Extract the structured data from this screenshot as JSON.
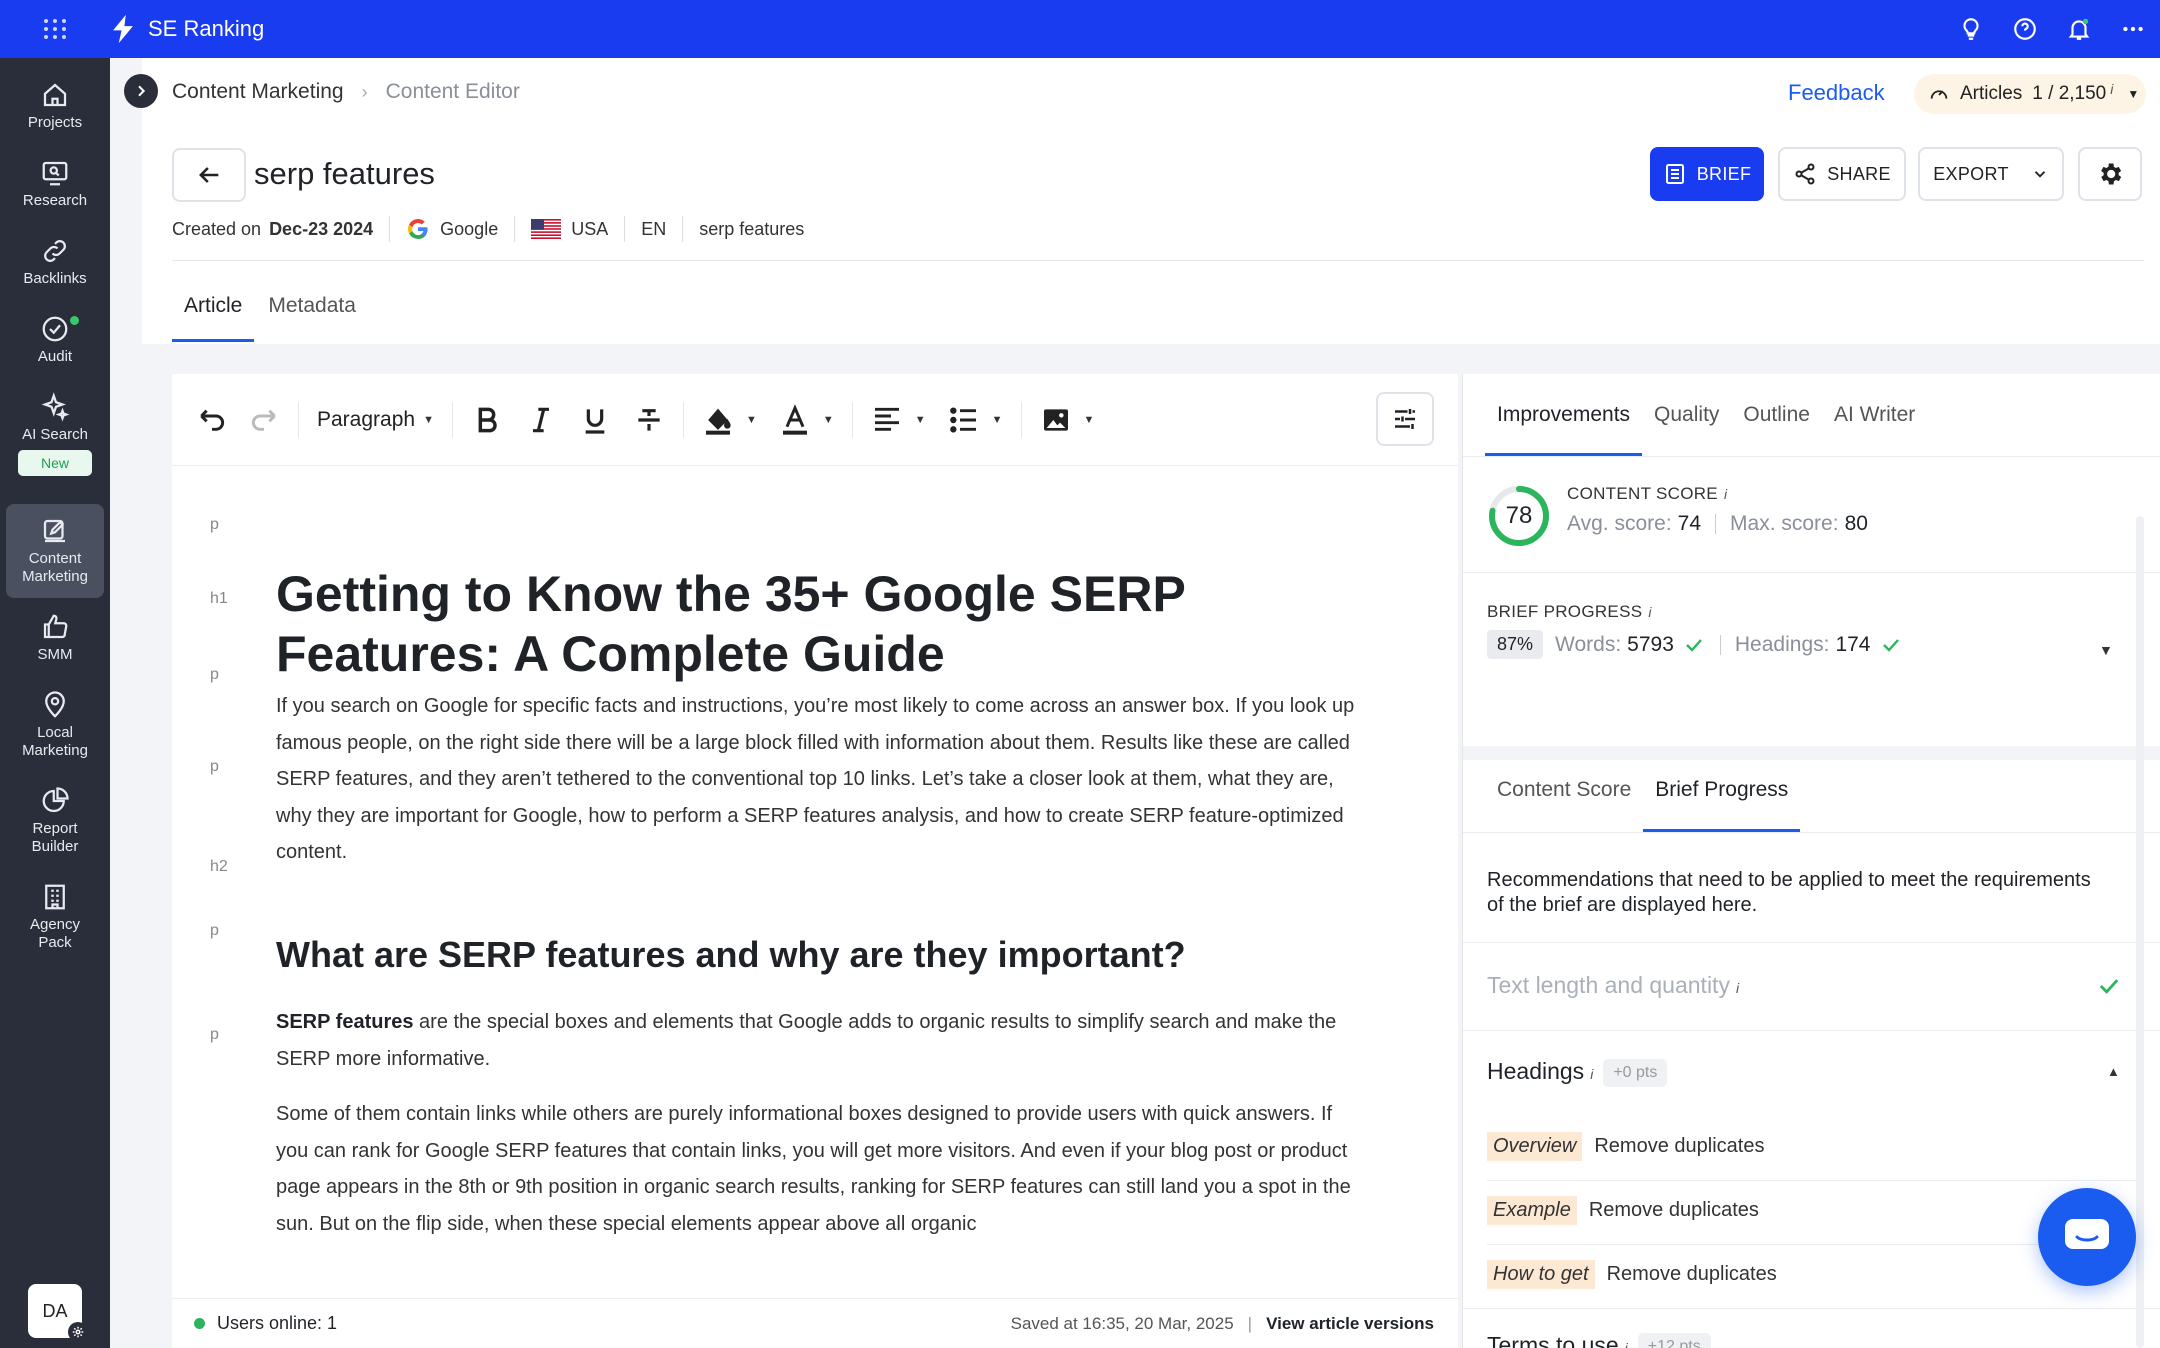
{
  "app": {
    "brand": "SE Ranking"
  },
  "colors": {
    "primary": "#1a3cf0",
    "sidebar": "#2a2e3a",
    "accent_green": "#2bb55d",
    "highlight": "#fde9d3"
  },
  "topbar": {
    "icons": [
      "lightbulb-icon",
      "help-icon",
      "bell-icon",
      "more-icon"
    ]
  },
  "sidebar": {
    "items": [
      {
        "label": "Projects",
        "icon": "home-icon"
      },
      {
        "label": "Research",
        "icon": "research-icon"
      },
      {
        "label": "Backlinks",
        "icon": "link-icon"
      },
      {
        "label": "Audit",
        "icon": "check-circle-icon"
      },
      {
        "label": "AI Search",
        "icon": "sparkle-icon",
        "badge": "New"
      },
      {
        "label": "Content\nMarketing",
        "icon": "edit-icon",
        "active": true
      },
      {
        "label": "SMM",
        "icon": "thumbs-up-icon"
      },
      {
        "label": "Local\nMarketing",
        "icon": "pin-icon"
      },
      {
        "label": "Report\nBuilder",
        "icon": "pie-chart-icon"
      },
      {
        "label": "Agency\nPack",
        "icon": "building-icon"
      }
    ],
    "avatar": "DA"
  },
  "header": {
    "breadcrumb": [
      "Content Marketing",
      "Content Editor"
    ],
    "feedback": "Feedback",
    "articles_label": "Articles",
    "articles_count": "1 / 2,150",
    "info": "i",
    "doc_title": "serp features",
    "created_label": "Created on",
    "created_date": "Dec-23 2024",
    "search_engine": "Google",
    "country": "USA",
    "language": "EN",
    "keyword": "serp features",
    "buttons": {
      "brief": "BRIEF",
      "share": "SHARE",
      "export": "EXPORT"
    },
    "tabs": [
      "Article",
      "Metadata"
    ]
  },
  "editor": {
    "toolbar": {
      "block_format": "Paragraph"
    },
    "tags": [
      "p",
      "h1",
      "p",
      "p",
      "h2",
      "p",
      "p"
    ],
    "h1": "Getting to Know the 35+ Google SERP Features: A Complete Guide",
    "p1": "If you search on Google for specific facts and instructions, you’re most likely to come across an answer box. If you look up famous people, on the right side there will be a large block filled with information about them. Results like these are called SERP features, and they aren’t tethered to the conventional top 10 links. Let’s take a closer look at them, what they are, why they are important for Google, how to perform a SERP features analysis, and how to create SERP feature-optimized content.",
    "h2": "What are SERP features and why are they important?",
    "p2_bold": "SERP features",
    "p2_rest": " are the special boxes and elements that Google adds to organic results to simplify search and make the SERP more informative.",
    "p3": "Some of them contain links while others are purely informational boxes designed to provide users with quick answers. If you can rank for Google SERP features that contain links, you will get more visitors. And even if your blog post or product page appears in the 8th or 9th position in organic search results, ranking for SERP features can still land you a spot in the sun. But on the flip side, when these special elements appear above all organic",
    "status": {
      "online": "Users online: 1",
      "saved": "Saved at 16:35, 20 Mar, 2025",
      "versions": "View article versions"
    }
  },
  "panel": {
    "tabs": [
      "Improvements",
      "Quality",
      "Outline",
      "AI Writer"
    ],
    "content_score": {
      "label": "CONTENT SCORE",
      "value": 78,
      "avg_label": "Avg. score:",
      "avg": "74",
      "max_label": "Max. score:",
      "max": "80"
    },
    "brief_progress": {
      "label": "BRIEF PROGRESS",
      "percent": "87%",
      "words_label": "Words:",
      "words": "5793",
      "headings_label": "Headings:",
      "headings": "174"
    },
    "subtabs": [
      "Content Score",
      "Brief Progress"
    ],
    "description": "Recommendations that need to be applied to meet the requirements of the brief are displayed here.",
    "sections": {
      "text_length": "Text length and quantity",
      "headings": "Headings",
      "headings_pts": "+0 pts",
      "terms": "Terms to use",
      "terms_pts": "+12 pts"
    },
    "heading_items": [
      {
        "tag": "Overview",
        "action": "Remove duplicates"
      },
      {
        "tag": "Example",
        "action": "Remove duplicates"
      },
      {
        "tag": "How to get",
        "action": "Remove duplicates"
      }
    ]
  }
}
